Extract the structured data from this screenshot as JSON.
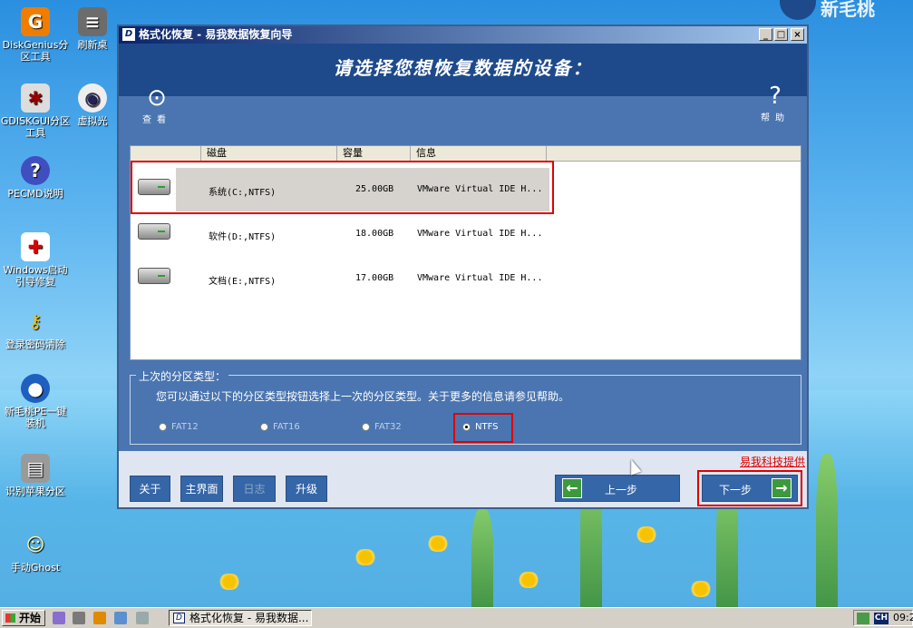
{
  "desktop": {
    "icons": [
      {
        "label": "DiskGenius分区工具",
        "name": "diskgenius-icon"
      },
      {
        "label": "刷新桌",
        "name": "refresh-desktop-icon"
      },
      {
        "label": "GDISKGUI分区工具",
        "name": "gdiskgui-icon"
      },
      {
        "label": "虚拟光",
        "name": "virtual-cd-icon"
      },
      {
        "label": "PECMD说明",
        "name": "pecmd-help-icon"
      },
      {
        "label": "Windows启动引导修复",
        "name": "boot-repair-icon"
      },
      {
        "label": "登录密码清除",
        "name": "password-clear-icon"
      },
      {
        "label": "新毛桃PE一键装机",
        "name": "pe-install-icon"
      },
      {
        "label": "识别苹果分区",
        "name": "apple-partition-icon"
      },
      {
        "label": "手动Ghost",
        "name": "manual-ghost-icon"
      }
    ],
    "brand_text": "新毛桃"
  },
  "window": {
    "title": "格式化恢复 - 易我数据恢复向导",
    "controls": {
      "minimize": "_",
      "maximize": "□",
      "close": "×"
    },
    "heading": "请选择您想恢复数据的设备：",
    "tools": {
      "view_label": "查看",
      "help_label": "帮助",
      "help_glyph": "?"
    },
    "list": {
      "columns": [
        "磁盘",
        "容量",
        "信息"
      ],
      "rows": [
        {
          "disk": "系统(C:,NTFS)",
          "capacity": "25.00GB",
          "info": "VMware Virtual IDE H...",
          "selected": true
        },
        {
          "disk": "软件(D:,NTFS)",
          "capacity": "18.00GB",
          "info": "VMware Virtual IDE H...",
          "selected": false
        },
        {
          "disk": "文档(E:,NTFS)",
          "capacity": "17.00GB",
          "info": "VMware Virtual IDE H...",
          "selected": false
        }
      ]
    },
    "partition_group": {
      "legend": "上次的分区类型：",
      "description": "您可以通过以下的分区类型按钮选择上一次的分区类型。关于更多的信息请参见帮助。",
      "options": [
        "FAT12",
        "FAT16",
        "FAT32",
        "NTFS"
      ],
      "selected": "NTFS"
    },
    "link": "易我科技提供",
    "buttons": {
      "about": "关于",
      "main": "主界面",
      "log": "日志",
      "upgrade": "升级",
      "prev": "上一步",
      "next": "下一步"
    },
    "highlight_color": "#e00000"
  },
  "taskbar": {
    "start_label": "开始",
    "task_label": "格式化恢复 - 易我数据...",
    "ime": "CH",
    "clock": "09:2"
  }
}
